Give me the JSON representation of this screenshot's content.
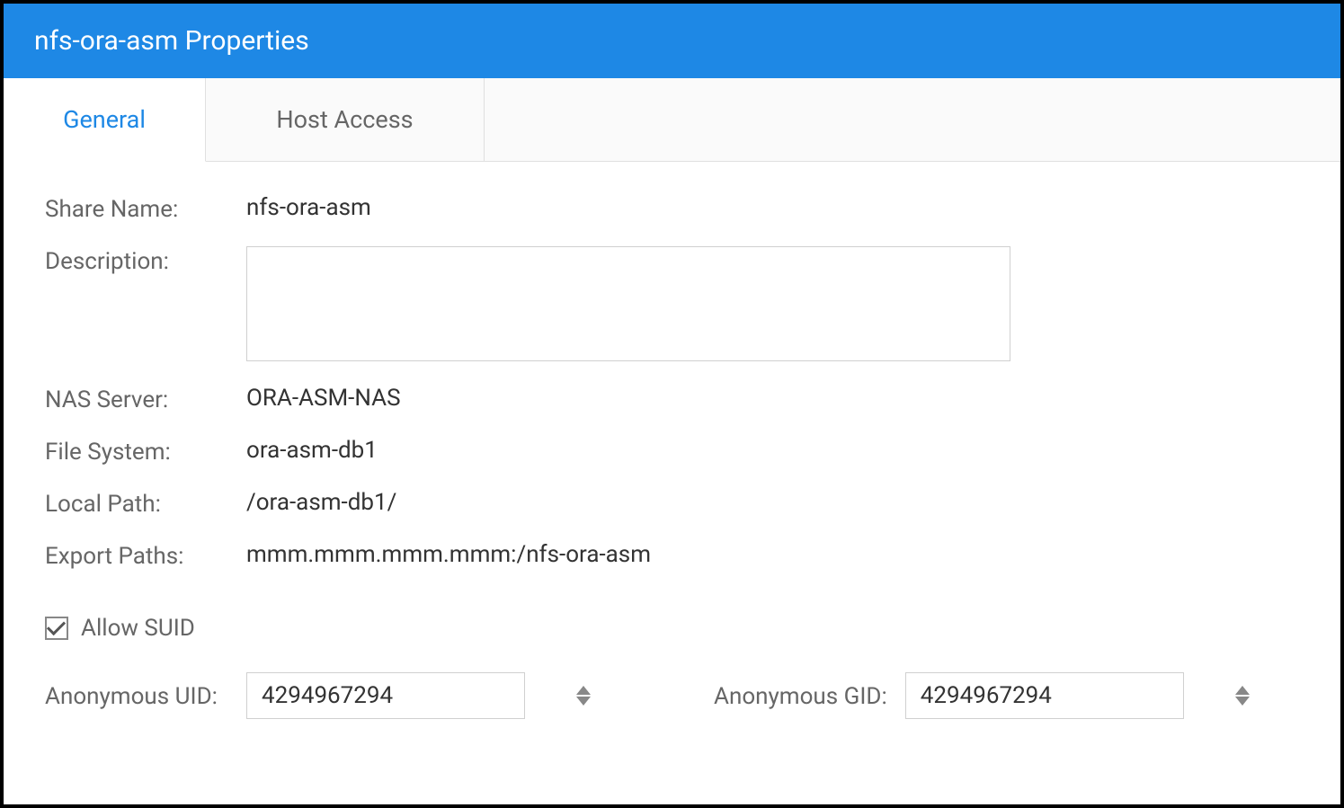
{
  "header": {
    "title": "nfs-ora-asm Properties"
  },
  "tabs": [
    {
      "label": "General",
      "active": true
    },
    {
      "label": "Host Access",
      "active": false
    }
  ],
  "fields": {
    "shareName": {
      "label": "Share Name:",
      "value": "nfs-ora-asm"
    },
    "description": {
      "label": "Description:",
      "value": ""
    },
    "nasServer": {
      "label": "NAS Server:",
      "value": "ORA-ASM-NAS"
    },
    "fileSystem": {
      "label": "File System:",
      "value": "ora-asm-db1"
    },
    "localPath": {
      "label": "Local Path:",
      "value": "/ora-asm-db1/"
    },
    "exportPaths": {
      "label": "Export Paths:",
      "value": "mmm.mmm.mmm.mmm:/nfs-ora-asm"
    },
    "allowSuid": {
      "label": "Allow SUID",
      "checked": true
    },
    "anonymousUid": {
      "label": "Anonymous UID:",
      "value": "4294967294"
    },
    "anonymousGid": {
      "label": "Anonymous GID:",
      "value": "4294967294"
    }
  }
}
